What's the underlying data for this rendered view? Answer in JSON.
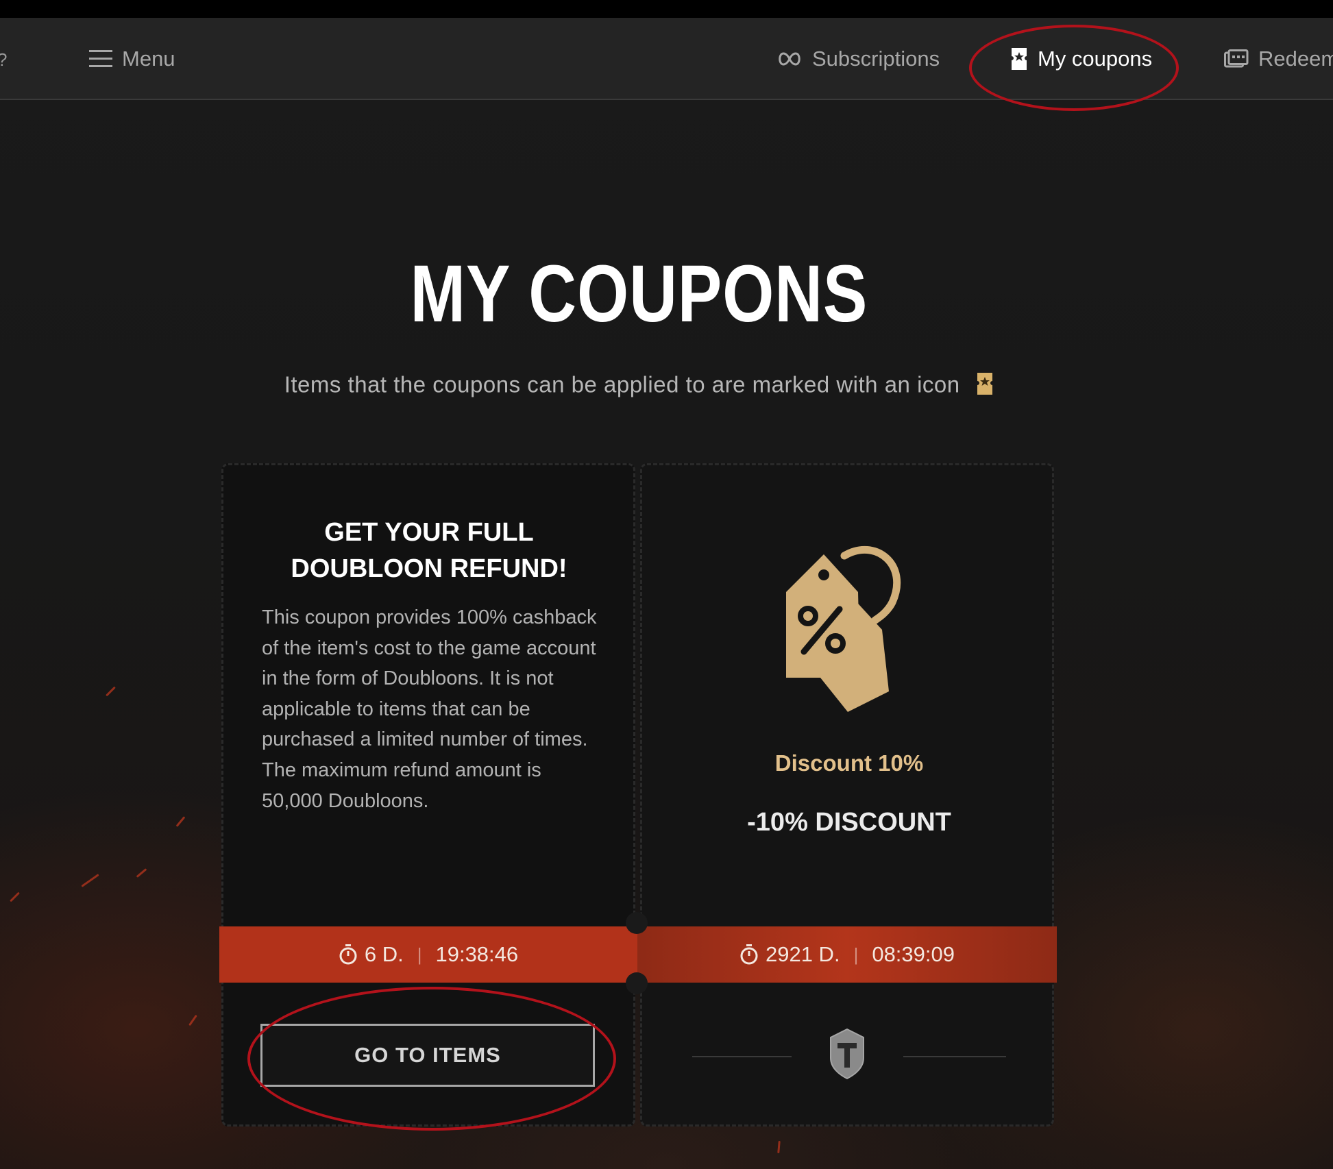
{
  "nav": {
    "menu_label": "Menu",
    "subscriptions_label": "Subscriptions",
    "coupons_label": "My coupons",
    "redeem_label": "Redeem"
  },
  "hero": {
    "title": "MY COUPONS",
    "subtitle": "Items that the coupons can be applied to are marked with an icon"
  },
  "coupons": [
    {
      "title": "GET YOUR FULL DOUBLOON REFUND!",
      "description": "This coupon provides 100% cashback of the item's cost to the game account in the form of Doubloons. It is not applicable to items that can be purchased a limited number of times. The maximum refund amount is 50,000 Doubloons.",
      "timer_days": "6 D.",
      "timer_time": "19:38:46",
      "button_label": "GO TO ITEMS"
    },
    {
      "name": "Discount 10%",
      "value": "-10% DISCOUNT",
      "timer_days": "2921 D.",
      "timer_time": "08:39:09",
      "icon": "discount-tag-icon",
      "footer_icon": "wot-emblem-icon"
    }
  ],
  "colors": {
    "accent_red": "#b2321a",
    "gold": "#e2c08b",
    "annotation_red": "#b3121b"
  }
}
